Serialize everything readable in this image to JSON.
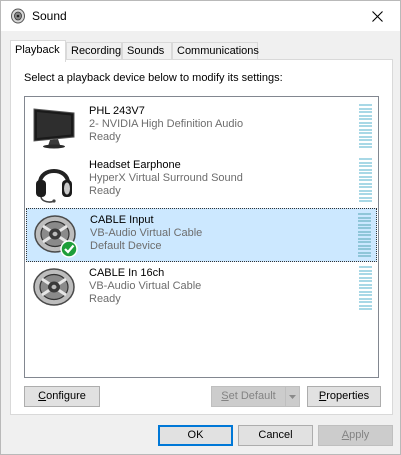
{
  "window": {
    "title": "Sound",
    "icon": "speaker-icon",
    "close_glyph": "✕"
  },
  "tabs": [
    {
      "label": "Playback",
      "active": true
    },
    {
      "label": "Recording",
      "active": false
    },
    {
      "label": "Sounds",
      "active": false
    },
    {
      "label": "Communications",
      "active": false
    }
  ],
  "instruction": "Select a playback device below to modify its settings:",
  "devices": [
    {
      "name": "PHL 243V7",
      "description": "2- NVIDIA High Definition Audio",
      "status": "Ready",
      "icon": "monitor-icon",
      "selected": false,
      "is_default": false
    },
    {
      "name": "Headset Earphone",
      "description": "HyperX Virtual Surround Sound",
      "status": "Ready",
      "icon": "headset-icon",
      "selected": false,
      "is_default": false
    },
    {
      "name": "CABLE Input",
      "description": "VB-Audio Virtual Cable",
      "status": "Default Device",
      "icon": "speaker-cable-icon",
      "selected": true,
      "is_default": true
    },
    {
      "name": "CABLE In 16ch",
      "description": "VB-Audio Virtual Cable",
      "status": "Ready",
      "icon": "speaker-cable-icon",
      "selected": false,
      "is_default": false
    }
  ],
  "buttons": {
    "configure": {
      "prefix": "",
      "accel": "C",
      "rest": "onfigure"
    },
    "set_default": {
      "prefix": "",
      "accel": "S",
      "rest": "et Default"
    },
    "properties": {
      "prefix": "",
      "accel": "P",
      "rest": "roperties"
    },
    "ok": "OK",
    "cancel": "Cancel",
    "apply": {
      "prefix": "",
      "accel": "A",
      "rest": "pply"
    }
  },
  "colors": {
    "selection": "#cce8ff",
    "accent": "#0078d7",
    "default_check": "#1e9e3a"
  }
}
